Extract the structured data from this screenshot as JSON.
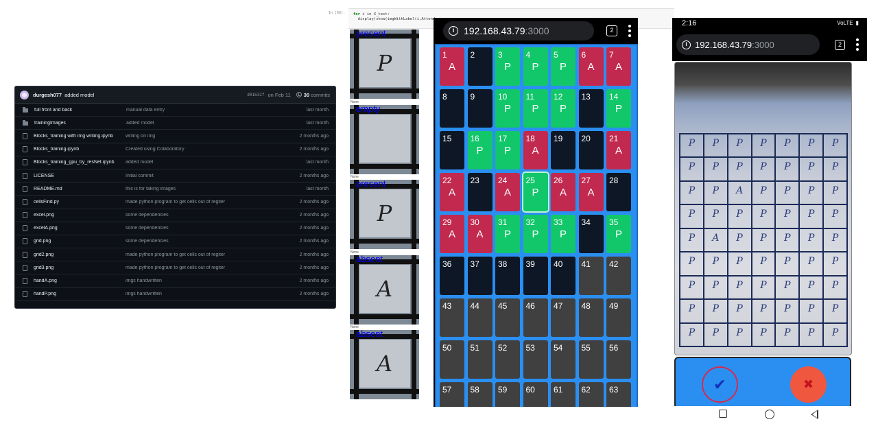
{
  "github": {
    "latest_commit": {
      "author": "durgesh077",
      "message": "added model",
      "sha": "d01632f",
      "date": "on Feb 11",
      "count": "30",
      "count_label": "commits"
    },
    "files": [
      {
        "type": "folder",
        "name": "full front and back",
        "message": "manual data entry",
        "age": "last month"
      },
      {
        "type": "folder",
        "name": "trainingImages",
        "message": "added model",
        "age": "last month"
      },
      {
        "type": "file",
        "name": "Blocks_training with img writing.ipynb",
        "message": "writing on img",
        "age": "2 months ago"
      },
      {
        "type": "file",
        "name": "Blocks_training.ipynb",
        "message": "Created using Colaboratory",
        "age": "2 months ago"
      },
      {
        "type": "file",
        "name": "Blocks_training_gpu_by_resNet.ipynb",
        "message": "added model",
        "age": "last month"
      },
      {
        "type": "file",
        "name": "LICENSE",
        "message": "Initial commit",
        "age": "2 months ago"
      },
      {
        "type": "file",
        "name": "README.md",
        "message": "this is for taking images",
        "age": "last month"
      },
      {
        "type": "file",
        "name": "cellsFind.py",
        "message": "made python program to get cells out of regiter",
        "age": "2 months ago"
      },
      {
        "type": "file",
        "name": "excel.png",
        "message": "some dependencies",
        "age": "2 months ago"
      },
      {
        "type": "file",
        "name": "excelA.png",
        "message": "some dependencies",
        "age": "2 months ago"
      },
      {
        "type": "file",
        "name": "grid.png",
        "message": "some dependencies",
        "age": "2 months ago"
      },
      {
        "type": "file",
        "name": "grid2.png",
        "message": "made python program to get cells out of regiter",
        "age": "2 months ago"
      },
      {
        "type": "file",
        "name": "grid3.png",
        "message": "made python program to get cells out of regiter",
        "age": "2 months ago"
      },
      {
        "type": "file",
        "name": "handA.png",
        "message": "imgs handwritten",
        "age": "2 months ago"
      },
      {
        "type": "file",
        "name": "handP.png",
        "message": "imgs handwritten",
        "age": "2 months ago"
      }
    ]
  },
  "notebook": {
    "prompt": "In [66]:",
    "line1_kw": "for",
    "line1_rest": " i in X_test:",
    "line2": "  display(show(imgWithLabel(i,Attend"
  },
  "previews": [
    {
      "label": "present",
      "glyph": "P",
      "caption": ""
    },
    {
      "label": "empty",
      "glyph": "",
      "caption": "None"
    },
    {
      "label": "present",
      "glyph": "P",
      "caption": "None"
    },
    {
      "label": "absent",
      "glyph": "A",
      "caption": "None"
    },
    {
      "label": "absent",
      "glyph": "A",
      "caption": "None"
    }
  ],
  "phone1": {
    "url_host": "192.168.43.79",
    "url_port": ":3000",
    "tab_count": "2",
    "cells": [
      {
        "n": "1",
        "s": "A"
      },
      {
        "n": "2",
        "s": ""
      },
      {
        "n": "3",
        "s": "P"
      },
      {
        "n": "4",
        "s": "P"
      },
      {
        "n": "5",
        "s": "P"
      },
      {
        "n": "6",
        "s": "A"
      },
      {
        "n": "7",
        "s": "A"
      },
      {
        "n": "8",
        "s": ""
      },
      {
        "n": "9",
        "s": ""
      },
      {
        "n": "10",
        "s": "P"
      },
      {
        "n": "11",
        "s": "P"
      },
      {
        "n": "12",
        "s": "P"
      },
      {
        "n": "13",
        "s": ""
      },
      {
        "n": "14",
        "s": "P"
      },
      {
        "n": "15",
        "s": ""
      },
      {
        "n": "16",
        "s": "P"
      },
      {
        "n": "17",
        "s": "P"
      },
      {
        "n": "18",
        "s": "A"
      },
      {
        "n": "19",
        "s": ""
      },
      {
        "n": "20",
        "s": ""
      },
      {
        "n": "21",
        "s": "A"
      },
      {
        "n": "22",
        "s": "A"
      },
      {
        "n": "23",
        "s": ""
      },
      {
        "n": "24",
        "s": "A"
      },
      {
        "n": "25",
        "s": "P"
      },
      {
        "n": "26",
        "s": "A"
      },
      {
        "n": "27",
        "s": "A"
      },
      {
        "n": "28",
        "s": ""
      },
      {
        "n": "29",
        "s": "A"
      },
      {
        "n": "30",
        "s": "A"
      },
      {
        "n": "31",
        "s": "P"
      },
      {
        "n": "32",
        "s": "P"
      },
      {
        "n": "33",
        "s": "P"
      },
      {
        "n": "34",
        "s": ""
      },
      {
        "n": "35",
        "s": "P"
      },
      {
        "n": "36",
        "s": ""
      },
      {
        "n": "37",
        "s": ""
      },
      {
        "n": "38",
        "s": ""
      },
      {
        "n": "39",
        "s": ""
      },
      {
        "n": "40",
        "s": ""
      },
      {
        "n": "41",
        "s": ""
      },
      {
        "n": "42",
        "s": ""
      },
      {
        "n": "43",
        "s": ""
      },
      {
        "n": "44",
        "s": ""
      },
      {
        "n": "45",
        "s": ""
      },
      {
        "n": "46",
        "s": ""
      },
      {
        "n": "47",
        "s": ""
      },
      {
        "n": "48",
        "s": ""
      },
      {
        "n": "49",
        "s": ""
      },
      {
        "n": "50",
        "s": ""
      },
      {
        "n": "51",
        "s": ""
      },
      {
        "n": "52",
        "s": ""
      },
      {
        "n": "53",
        "s": ""
      },
      {
        "n": "54",
        "s": ""
      },
      {
        "n": "55",
        "s": ""
      },
      {
        "n": "56",
        "s": ""
      },
      {
        "n": "57",
        "s": ""
      },
      {
        "n": "58",
        "s": ""
      },
      {
        "n": "59",
        "s": ""
      },
      {
        "n": "60",
        "s": ""
      },
      {
        "n": "61",
        "s": ""
      },
      {
        "n": "62",
        "s": ""
      },
      {
        "n": "63",
        "s": ""
      }
    ],
    "dark_cells": [
      "2",
      "8",
      "9",
      "13",
      "15",
      "19",
      "20",
      "23",
      "28",
      "34",
      "36",
      "37",
      "38",
      "39",
      "40"
    ],
    "selected_cell": "25",
    "colors": {
      "absent": "#c2294f",
      "present": "#12c76a",
      "unfilled": "#0e1726",
      "empty": "#404040",
      "background": "#2b8ff1"
    }
  },
  "phone2": {
    "status_time": "2:16",
    "status_icons": "VoLTE",
    "url_host": "192.168.43.79",
    "url_port": ":3000",
    "tab_count": "2",
    "register_marks": [
      "P",
      "P",
      "P",
      "P",
      "P",
      "P",
      "P",
      "P",
      "P",
      "P",
      "P",
      "P",
      "P",
      "P",
      "P",
      "P",
      "A",
      "P",
      "P",
      "P",
      "P",
      "P",
      "P",
      "P",
      "P",
      "P",
      "P",
      "P",
      "P",
      "A",
      "P",
      "P",
      "P",
      "P",
      "P",
      "P",
      "P",
      "P",
      "P",
      "P",
      "P",
      "P",
      "P",
      "P",
      "P",
      "P",
      "P",
      "P",
      "P",
      "P",
      "P",
      "P",
      "P",
      "P",
      "P",
      "P",
      "P",
      "P",
      "P",
      "P",
      "P",
      "P",
      "P"
    ],
    "confirm_icon": "check-icon",
    "reject_icon": "close-icon"
  }
}
